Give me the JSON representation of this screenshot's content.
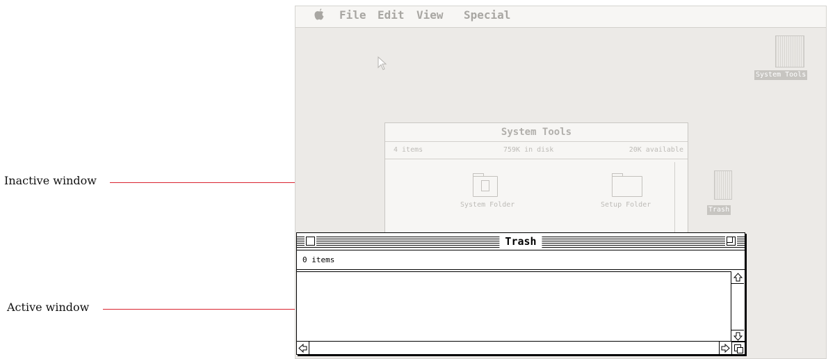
{
  "callouts": {
    "inactive": "Inactive window",
    "active": "Active window"
  },
  "menubar": {
    "apple_icon": "apple-icon",
    "items": [
      "File",
      "Edit",
      "View",
      "Special"
    ]
  },
  "desktop": {
    "disk_icon_label": "System Tools",
    "trash_icon_label": "Trash"
  },
  "inactive_window": {
    "title": "System Tools",
    "items_count": "4 items",
    "in_disk": "759K in disk",
    "available": "20K available",
    "folders": [
      "System Folder",
      "Setup Folder"
    ]
  },
  "active_window": {
    "title": "Trash",
    "items_count": "0 items"
  },
  "colors": {
    "callout_line": "#d9232e",
    "dimmed_screen": "#eceae7"
  }
}
